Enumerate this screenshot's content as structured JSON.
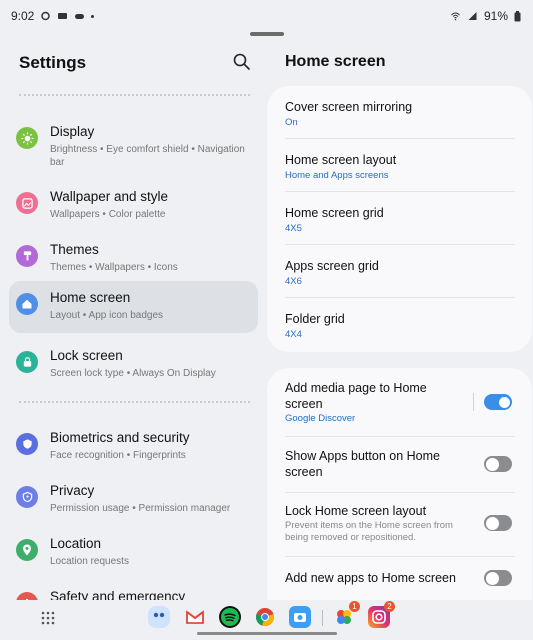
{
  "status": {
    "time": "9:02",
    "battery": "91%"
  },
  "left": {
    "title": "Settings",
    "items": [
      {
        "title": "Display",
        "sub": "Brightness  •  Eye comfort shield  •  Navigation bar",
        "color": "#7cc242",
        "icon": "sun-icon"
      },
      {
        "title": "Wallpaper and style",
        "sub": "Wallpapers  •  Color palette",
        "color": "#ef6f92",
        "icon": "image-icon"
      },
      {
        "title": "Themes",
        "sub": "Themes  •  Wallpapers  •  Icons",
        "color": "#b26ad9",
        "icon": "brush-icon"
      },
      {
        "title": "Home screen",
        "sub": "Layout  •  App icon badges",
        "color": "#4f8fe8",
        "icon": "home-icon"
      },
      {
        "title": "Lock screen",
        "sub": "Screen lock type  •  Always On Display",
        "color": "#2bb39a",
        "icon": "lock-icon"
      },
      {
        "title": "Biometrics and security",
        "sub": "Face recognition  •  Fingerprints",
        "color": "#5b6fe0",
        "icon": "shield-icon"
      },
      {
        "title": "Privacy",
        "sub": "Permission usage  •  Permission manager",
        "color": "#6d7fe6",
        "icon": "privacy-shield-icon"
      },
      {
        "title": "Location",
        "sub": "Location requests",
        "color": "#3fae6c",
        "icon": "location-pin-icon"
      },
      {
        "title": "Safety and emergency",
        "sub": "",
        "color": "#e4584f",
        "icon": "emergency-icon"
      }
    ]
  },
  "right": {
    "title": "Home screen",
    "card1": [
      {
        "title": "Cover screen mirroring",
        "sub": "On"
      },
      {
        "title": "Home screen layout",
        "sub": "Home and Apps screens"
      },
      {
        "title": "Home screen grid",
        "sub": "4X5"
      },
      {
        "title": "Apps screen grid",
        "sub": "4X6"
      },
      {
        "title": "Folder grid",
        "sub": "4X4"
      }
    ],
    "card2": [
      {
        "title": "Add media page to Home screen",
        "sub": "Google Discover",
        "toggle": "on"
      },
      {
        "title": "Show Apps button on Home screen",
        "toggle": "off"
      },
      {
        "title": "Lock Home screen layout",
        "desc": "Prevent items on the Home screen from being removed or repositioned.",
        "toggle": "off"
      },
      {
        "title": "Add new apps to Home screen",
        "toggle": "off"
      }
    ]
  },
  "dock": {
    "apps": [
      {
        "name": "app-drawer-icon"
      },
      {
        "name": "bixby-icon",
        "color": "#cfe3ff"
      },
      {
        "name": "gmail-icon",
        "color": "#ffffff"
      },
      {
        "name": "spotify-icon",
        "color": "#1db954"
      },
      {
        "name": "chrome-icon",
        "color": "#ffffff"
      },
      {
        "name": "camera-icon",
        "color": "#3ba0f5"
      },
      {
        "name": "photos-icon",
        "color": "#ffffff",
        "badge": "1"
      },
      {
        "name": "instagram-icon",
        "color": "#d6337f",
        "badge": "2"
      }
    ]
  }
}
